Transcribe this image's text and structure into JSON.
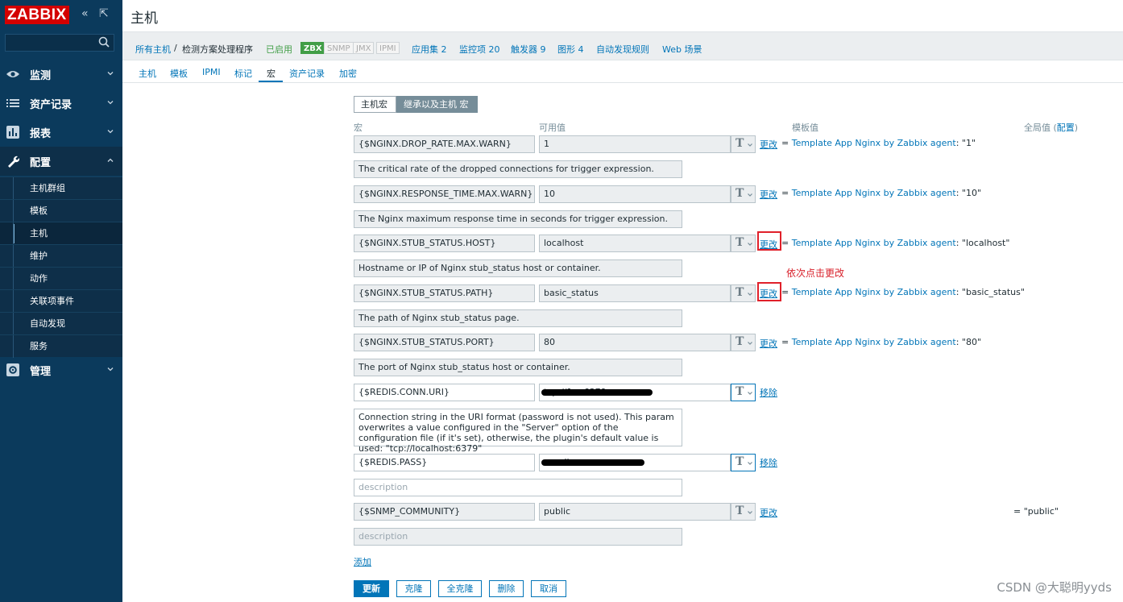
{
  "sidebar": {
    "logo": "ZABBIX",
    "collapse_icon": "«",
    "kiosk_icon": "⇱",
    "search_placeholder": "",
    "menu": [
      {
        "label": "监测"
      },
      {
        "label": "资产记录"
      },
      {
        "label": "报表"
      },
      {
        "label": "配置"
      },
      {
        "label": "管理"
      }
    ],
    "submenu": [
      {
        "label": "主机群组"
      },
      {
        "label": "模板"
      },
      {
        "label": "主机"
      },
      {
        "label": "维护"
      },
      {
        "label": "动作"
      },
      {
        "label": "关联项事件"
      },
      {
        "label": "自动发现"
      },
      {
        "label": "服务"
      }
    ]
  },
  "header": {
    "title": "主机",
    "breadcrumb_all": "所有主机",
    "breadcrumb_sep": "/",
    "breadcrumb_current": "检测方案处理程序",
    "enabled": "已启用",
    "zbx": "ZBX",
    "snmp": "SNMP",
    "jmx": "JMX",
    "ipmi": "IPMI",
    "apps": "应用集 2",
    "items": "监控项 20",
    "triggers": "触发器 9",
    "graphs": "图形 4",
    "discovery": "自动发现规则",
    "web": "Web 场景"
  },
  "tabs": [
    "主机",
    "模板",
    "IPMI",
    "标记",
    "宏",
    "资产记录",
    "加密"
  ],
  "toggle": {
    "host_macros": "主机宏",
    "inherited": "继承以及主机 宏"
  },
  "columns": {
    "macro": "宏",
    "effective": "可用值",
    "template": "模板值",
    "global": "全局值 (",
    "global_link": "配置",
    "global_close": ")"
  },
  "macros": [
    {
      "name": "{$NGINX.DROP_RATE.MAX.WARN}",
      "value": "1",
      "action": "更改",
      "eq": "=",
      "template": "Template App Nginx by Zabbix agent",
      "template_value": ": \"1\"",
      "description": "The critical rate of the dropped connections for trigger expression."
    },
    {
      "name": "{$NGINX.RESPONSE_TIME.MAX.WARN}",
      "value": "10",
      "action": "更改",
      "eq": "=",
      "template": "Template App Nginx by Zabbix agent",
      "template_value": ": \"10\"",
      "description": "The Nginx maximum response time in seconds for trigger expression."
    },
    {
      "name": "{$NGINX.STUB_STATUS.HOST}",
      "value": "localhost",
      "action": "更改",
      "eq": "=",
      "template": "Template App Nginx by Zabbix agent",
      "template_value": ": \"localhost\"",
      "description": "Hostname or IP of Nginx stub_status host or container."
    },
    {
      "name": "{$NGINX.STUB_STATUS.PATH}",
      "value": "basic_status",
      "action": "更改",
      "eq": "=",
      "template": "Template App Nginx by Zabbix agent",
      "template_value": ": \"basic_status\"",
      "description": "The path of Nginx stub_status page."
    },
    {
      "name": "{$NGINX.STUB_STATUS.PORT}",
      "value": "80",
      "action": "更改",
      "eq": "=",
      "template": "Template App Nginx by Zabbix agent",
      "template_value": ": \"80\"",
      "description": "The port of Nginx stub_status host or container."
    },
    {
      "name": "{$REDIS.CONN.URI}",
      "value": "tcp://1...:6379",
      "action": "移除",
      "description": "Connection string in the URI format (password is not used). This param overwrites a value configured in the \"Server\" option of the configuration file (if it's set), otherwise, the plugin's default value is used: \"tcp://localhost:6379\""
    },
    {
      "name": "{$REDIS.PASS}",
      "value": "...redis",
      "action": "移除",
      "description_placeholder": "description"
    },
    {
      "name": "{$SNMP_COMMUNITY}",
      "value": "public",
      "action": "更改",
      "global_value": "= \"public\"",
      "description_placeholder": "description"
    }
  ],
  "annotation": "依次点击更改",
  "add_link": "添加",
  "buttons": {
    "update": "更新",
    "clone": "克隆",
    "full_clone": "全克隆",
    "delete": "删除",
    "cancel": "取消"
  },
  "watermark": "CSDN @大聪明yyds",
  "colors": {
    "sidebar": "#0b3a5c",
    "logo": "#d40000",
    "link": "#0275b8",
    "enabled": "#429e47",
    "annotation": "#e0202a"
  }
}
